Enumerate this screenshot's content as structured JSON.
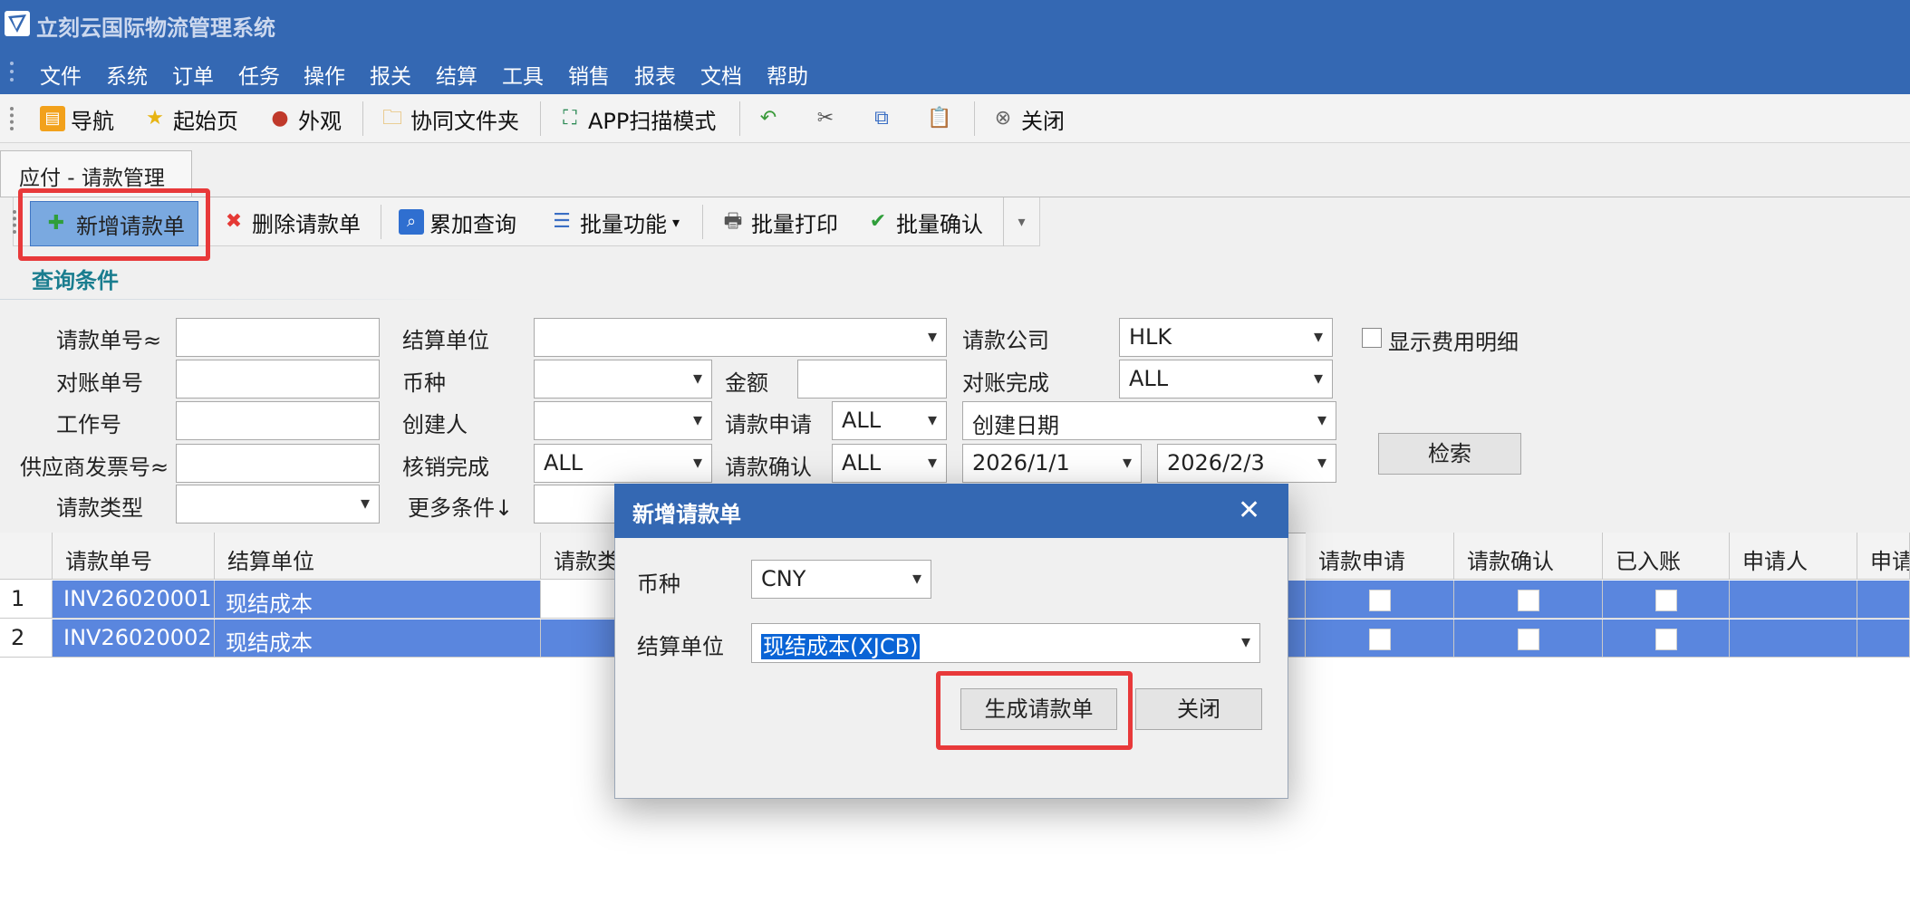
{
  "app": {
    "title": "立刻云国际物流管理系统"
  },
  "menu": [
    "文件",
    "系统",
    "订单",
    "任务",
    "操作",
    "报关",
    "结算",
    "工具",
    "销售",
    "报表",
    "文档",
    "帮助"
  ],
  "toolbar": {
    "nav": "导航",
    "home": "起始页",
    "appearance": "外观",
    "shared_folder": "协同文件夹",
    "app_scan": "APP扫描模式",
    "close": "关闭"
  },
  "tab": {
    "label": "应付 - 请款管理"
  },
  "actions": {
    "new": "新增请款单",
    "delete": "删除请款单",
    "accumulate_query": "累加查询",
    "batch_functions": "批量功能",
    "batch_print": "批量打印",
    "batch_confirm": "批量确认"
  },
  "query": {
    "title": "查询条件",
    "request_no_label": "请款单号≈",
    "reconcile_no_label": "对账单号",
    "job_no_label": "工作号",
    "supplier_invoice_label": "供应商发票号≈",
    "request_type_label": "请款类型",
    "settle_unit_label": "结算单位",
    "currency_label": "币种",
    "creator_label": "创建人",
    "writeoff_done_label": "核销完成",
    "writeoff_done_value": "ALL",
    "more_conditions_label": "更多条件↓",
    "amount_label": "金额",
    "request_apply_label": "请款申请",
    "request_apply_value": "ALL",
    "request_confirm_label": "请款确认",
    "request_confirm_value": "ALL",
    "company_label": "请款公司",
    "company_value": "HLK",
    "reconcile_done_label": "对账完成",
    "reconcile_done_value": "ALL",
    "date_type_value": "创建日期",
    "date_from": "2026/1/1",
    "date_to": "2026/2/3",
    "show_fee_detail_label": "显示费用明细",
    "search_button": "检索"
  },
  "grid": {
    "columns": [
      "请款单号",
      "结算单位",
      "请款类",
      "请款申请",
      "请款确认",
      "已入账",
      "申请人",
      "申请"
    ],
    "rows": [
      {
        "num": "1",
        "request_no": "INV26020001",
        "settle_unit": "现结成本"
      },
      {
        "num": "2",
        "request_no": "INV26020002",
        "settle_unit": "现结成本"
      }
    ]
  },
  "dialog": {
    "title": "新增请款单",
    "currency_label": "币种",
    "currency_value": "CNY",
    "settle_unit_label": "结算单位",
    "settle_unit_value": "现结成本(XJCB)",
    "generate_button": "生成请款单",
    "close_button": "关闭"
  },
  "colors": {
    "header_blue": "#3468b3",
    "selection_blue": "#5a86de",
    "highlight_red": "#e8393a"
  }
}
